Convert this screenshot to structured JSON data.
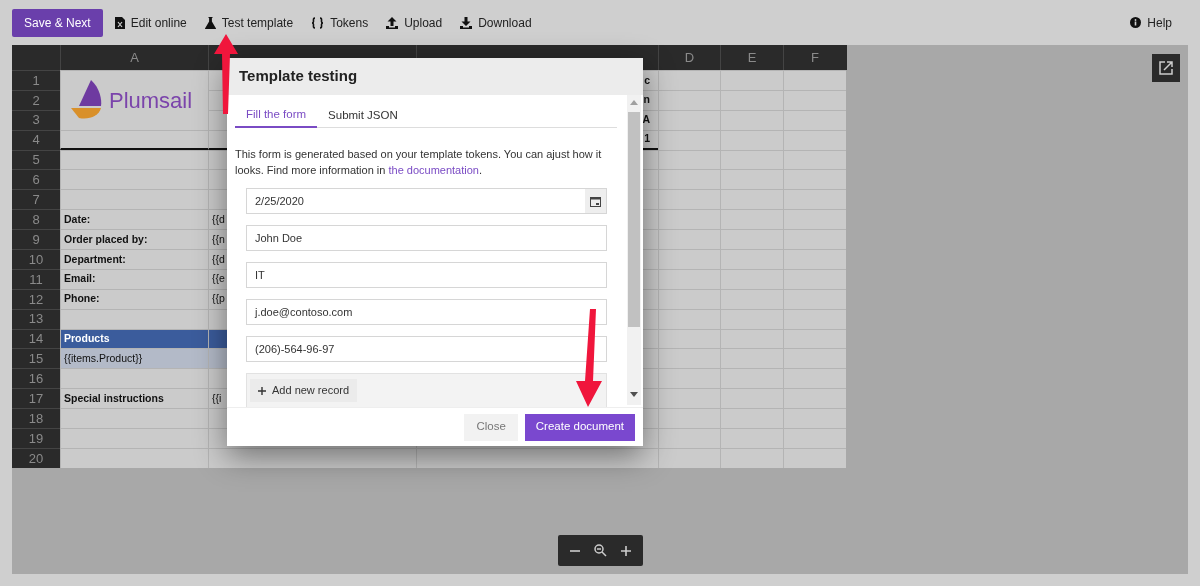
{
  "toolbar": {
    "buttons": [
      {
        "label": "Save & Next",
        "kind": "primary"
      },
      {
        "label": "Edit online",
        "kind": "action"
      },
      {
        "label": "Test template",
        "kind": "action"
      },
      {
        "label": "Tokens",
        "kind": "action"
      },
      {
        "label": "Upload",
        "kind": "action"
      },
      {
        "label": "Download",
        "kind": "action"
      }
    ],
    "help": "Help"
  },
  "sheet": {
    "columns": [
      "A",
      "D",
      "E",
      "F"
    ],
    "logo_text": "Plumsail",
    "rows": [
      {
        "number": "1",
        "kind": "logo",
        "col_c": "c"
      },
      {
        "number": "2",
        "kind": "logo",
        "col_c": "n"
      },
      {
        "number": "3",
        "kind": "logo",
        "col_c": "A"
      },
      {
        "number": "4",
        "kind": "ruled",
        "col_c": "1"
      },
      {
        "number": "5",
        "kind": "plain"
      },
      {
        "number": "6",
        "kind": "plain"
      },
      {
        "number": "7",
        "kind": "plain"
      },
      {
        "number": "8",
        "kind": "label",
        "col_a": "Date:",
        "col_b": "{{d"
      },
      {
        "number": "9",
        "kind": "label",
        "col_a": "Order placed by:",
        "col_b": "{{n"
      },
      {
        "number": "10",
        "kind": "label",
        "col_a": "Department:",
        "col_b": "{{d"
      },
      {
        "number": "11",
        "kind": "label",
        "col_a": "Email:",
        "col_b": "{{e"
      },
      {
        "number": "12",
        "kind": "label",
        "col_a": "Phone:",
        "col_b": "{{p"
      },
      {
        "number": "13",
        "kind": "plain"
      },
      {
        "number": "14",
        "kind": "band",
        "col_a": "Products"
      },
      {
        "number": "15",
        "kind": "token",
        "col_a": "{{items.Product}}"
      },
      {
        "number": "16",
        "kind": "plain"
      },
      {
        "number": "17",
        "kind": "label",
        "col_a": "Special instructions",
        "col_b": "{{i"
      },
      {
        "number": "18",
        "kind": "plain"
      },
      {
        "number": "19",
        "kind": "plain"
      },
      {
        "number": "20",
        "kind": "plain"
      }
    ]
  },
  "dialog": {
    "title": "Template testing",
    "tabs": [
      {
        "label": "Fill the form",
        "selected": true
      },
      {
        "label": "Submit JSON",
        "selected": false
      }
    ],
    "description": "This form is generated based on your template tokens. You can ajust how it looks. Find more information in ",
    "link": "the documentation",
    "description_end": ".",
    "fields": [
      {
        "kind": "date",
        "value": "2/25/2020"
      },
      {
        "kind": "text",
        "value": "John Doe"
      },
      {
        "kind": "text",
        "value": "IT"
      },
      {
        "kind": "text",
        "value": "j.doe@contoso.com"
      },
      {
        "kind": "text",
        "value": "(206)-564-96-97"
      }
    ],
    "add_record": "Add new record",
    "buttons": [
      {
        "label": "Close",
        "kind": "secondary"
      },
      {
        "label": "Create document",
        "kind": "primary"
      }
    ]
  }
}
